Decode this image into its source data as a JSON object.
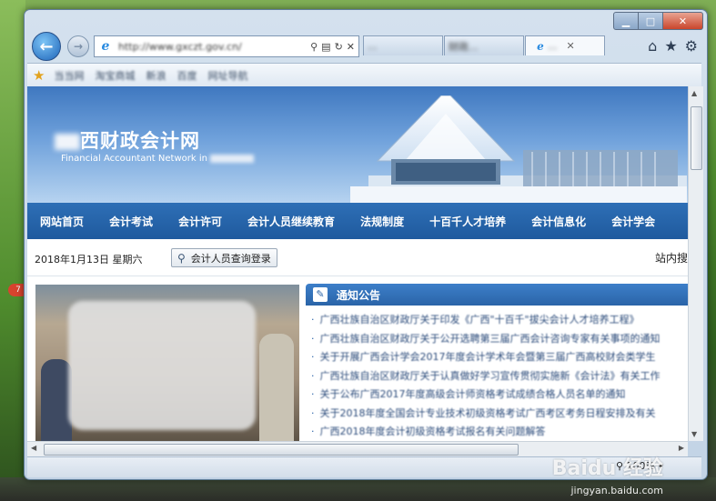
{
  "browser": {
    "address_url": "http://www.gxczt.gov.cn/",
    "tabs": [
      {
        "label": "...",
        "blurred": true
      },
      {
        "label": "财政...",
        "blurred": true
      },
      {
        "label": "...",
        "active": true,
        "blurred": true
      }
    ],
    "favorites": [
      "当当网",
      "淘宝商城",
      "新浪",
      "百度",
      "网址导航"
    ],
    "zoom": "100%"
  },
  "site": {
    "title": "西财政会计网",
    "subtitle": "Financial Accountant Network in"
  },
  "menu": [
    "网站首页",
    "会计考试",
    "会计许可",
    "会计人员继续教育",
    "法规制度",
    "十百千人才培养",
    "会计信息化",
    "会计学会"
  ],
  "datebar": {
    "date": "2018年1月13日  星期六",
    "search_button": "会计人员查询登录",
    "site_search": "站内搜"
  },
  "notice": {
    "title": "通知公告",
    "items": [
      "广西壮族自治区财政厅关于印发《广西\"十百千\"拔尖会计人才培养工程》",
      "广西壮族自治区财政厅关于公开选聘第三届广西会计咨询专家有关事项的通知",
      "关于开展广西会计学会2017年度会计学术年会暨第三届广西高校财会类学生",
      "广西壮族自治区财政厅关于认真做好学习宣传贯彻实施新《会计法》有关工作",
      "关于公布广西2017年度高级会计师资格考试成绩合格人员名单的通知",
      "关于2018年度全国会计专业技术初级资格考试广西考区考务日程安排及有关",
      "广西2018年度会计初级资格考试报名有关问题解答"
    ]
  },
  "desktop": {
    "badge": "7"
  },
  "watermark": {
    "brand": "Baidu 经验",
    "url": "jingyan.baidu.com"
  }
}
